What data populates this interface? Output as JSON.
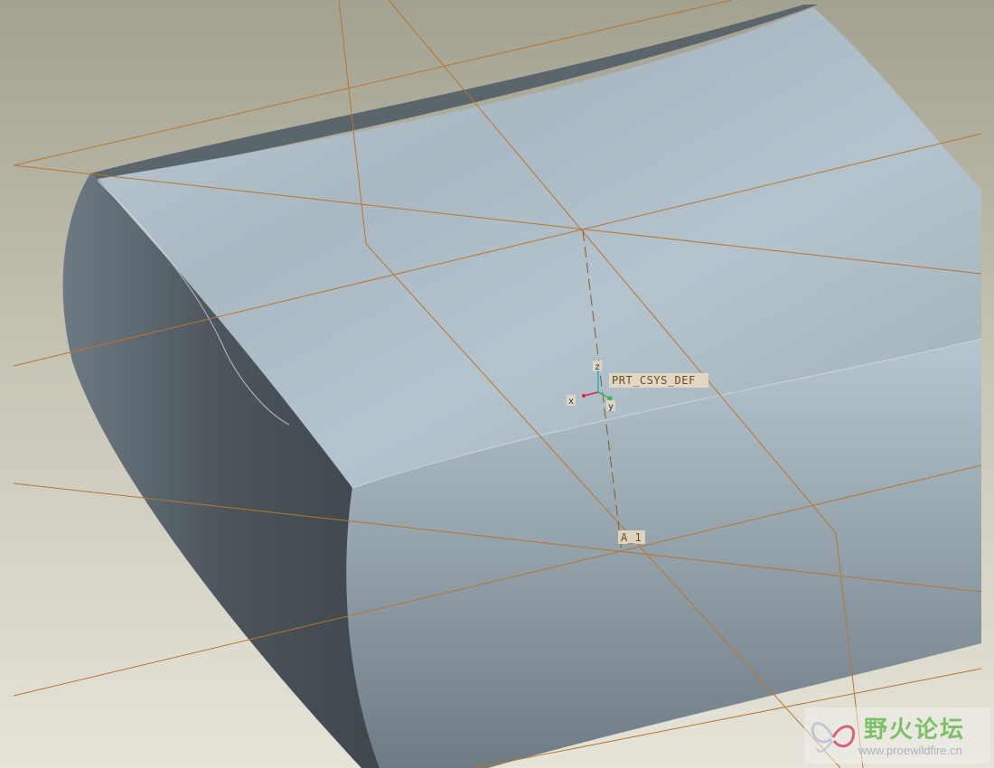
{
  "viewport": {
    "background_top": "#a7a593",
    "background_bottom": "#e4e1d6",
    "datum_color": "#b8762f"
  },
  "annotations": {
    "csys_label": "PRT_CSYS_DEF",
    "axis_label": "A_1",
    "csys_x": "x",
    "csys_y": "y",
    "csys_z": "z"
  },
  "watermark": {
    "title": "野火论坛",
    "url": "www.proewildfire.cn",
    "icon": "butterfly-logo-icon"
  }
}
